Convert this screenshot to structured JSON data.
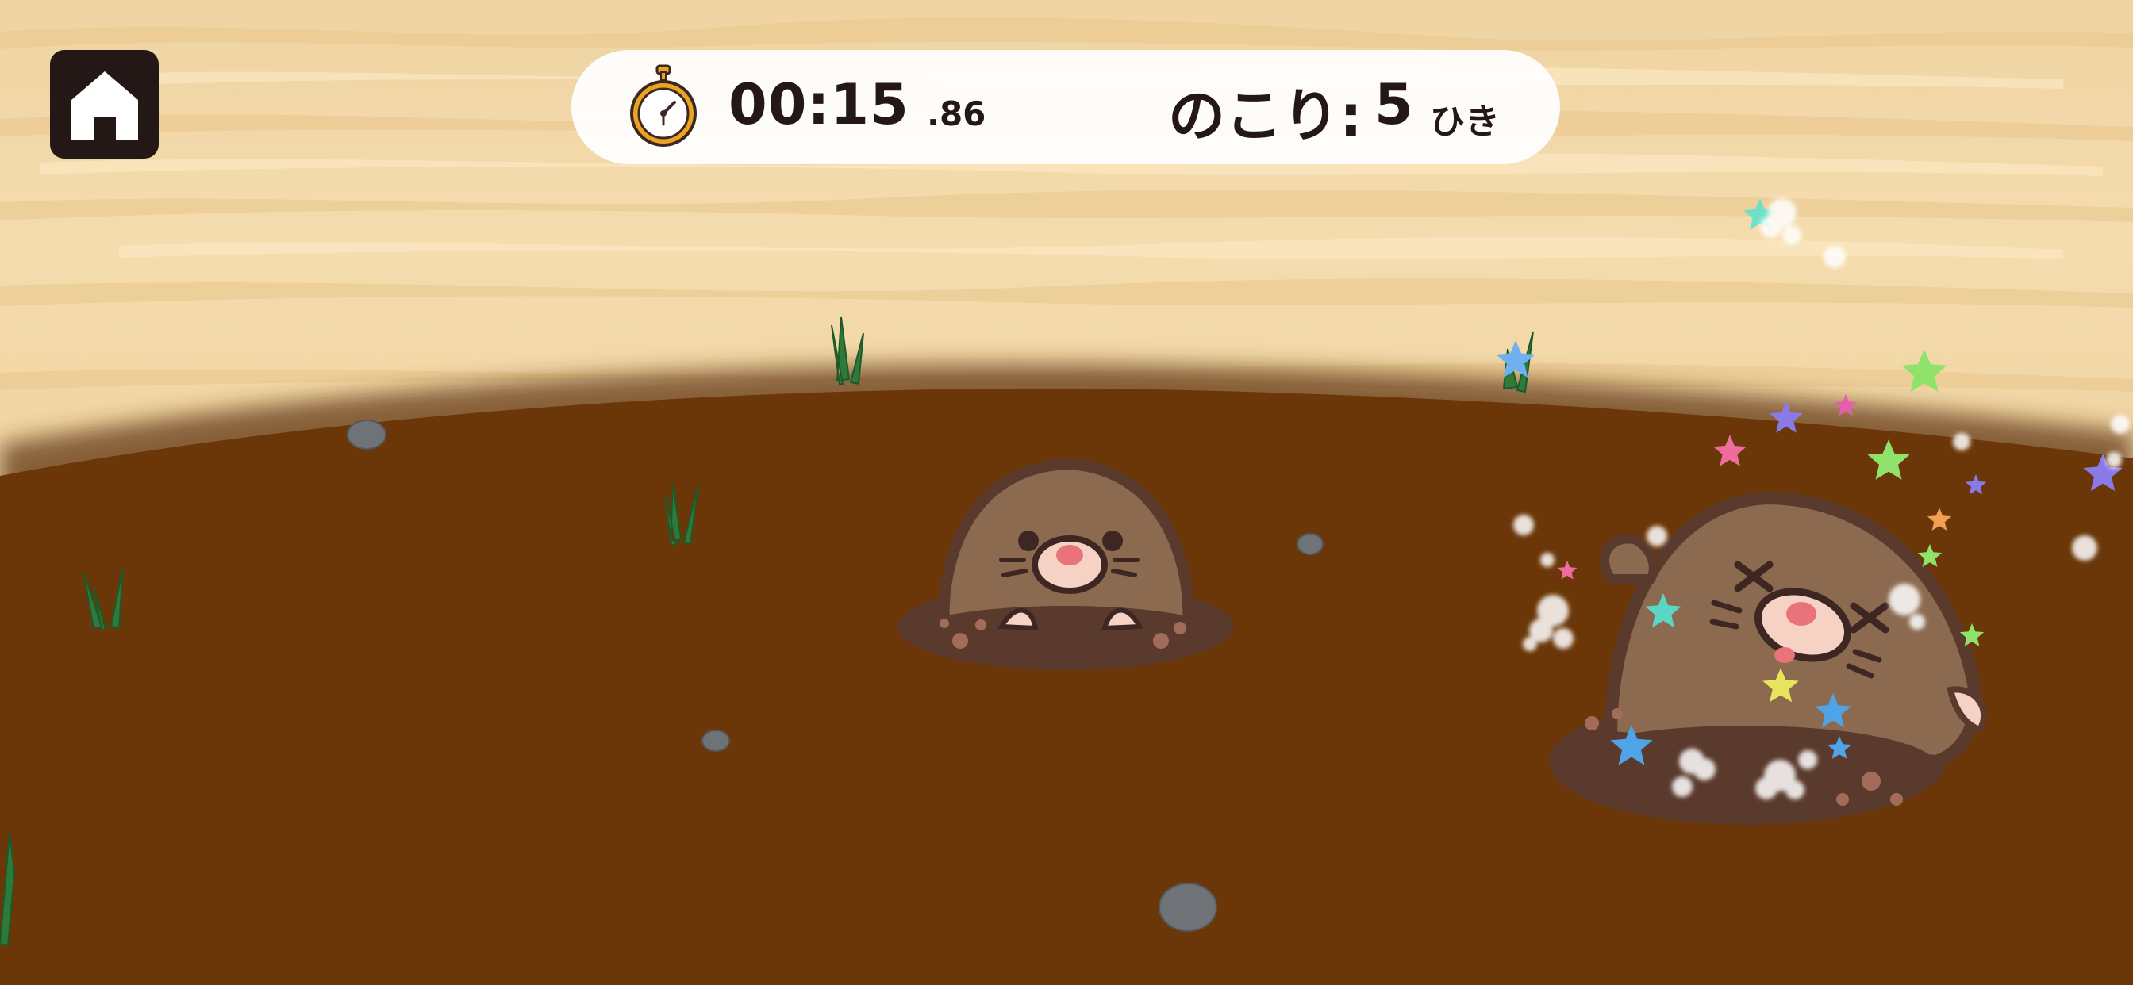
{
  "hud": {
    "timer_main": "00:15",
    "timer_fraction": ".86",
    "remaining_label": "のこり:",
    "remaining_count": "5",
    "remaining_unit": "ひき"
  },
  "icons": {
    "home": "home-icon",
    "timer": "stopwatch-icon"
  },
  "moles": [
    {
      "id": "center",
      "state": "up"
    },
    {
      "id": "right",
      "state": "hit"
    }
  ],
  "colors": {
    "ground": "#6b3708",
    "sand": "#f3d9a6",
    "mole_body": "#8c6a4f",
    "mole_outline": "#5a3a2c",
    "hud_text": "#231815",
    "home_bg": "#231815"
  }
}
